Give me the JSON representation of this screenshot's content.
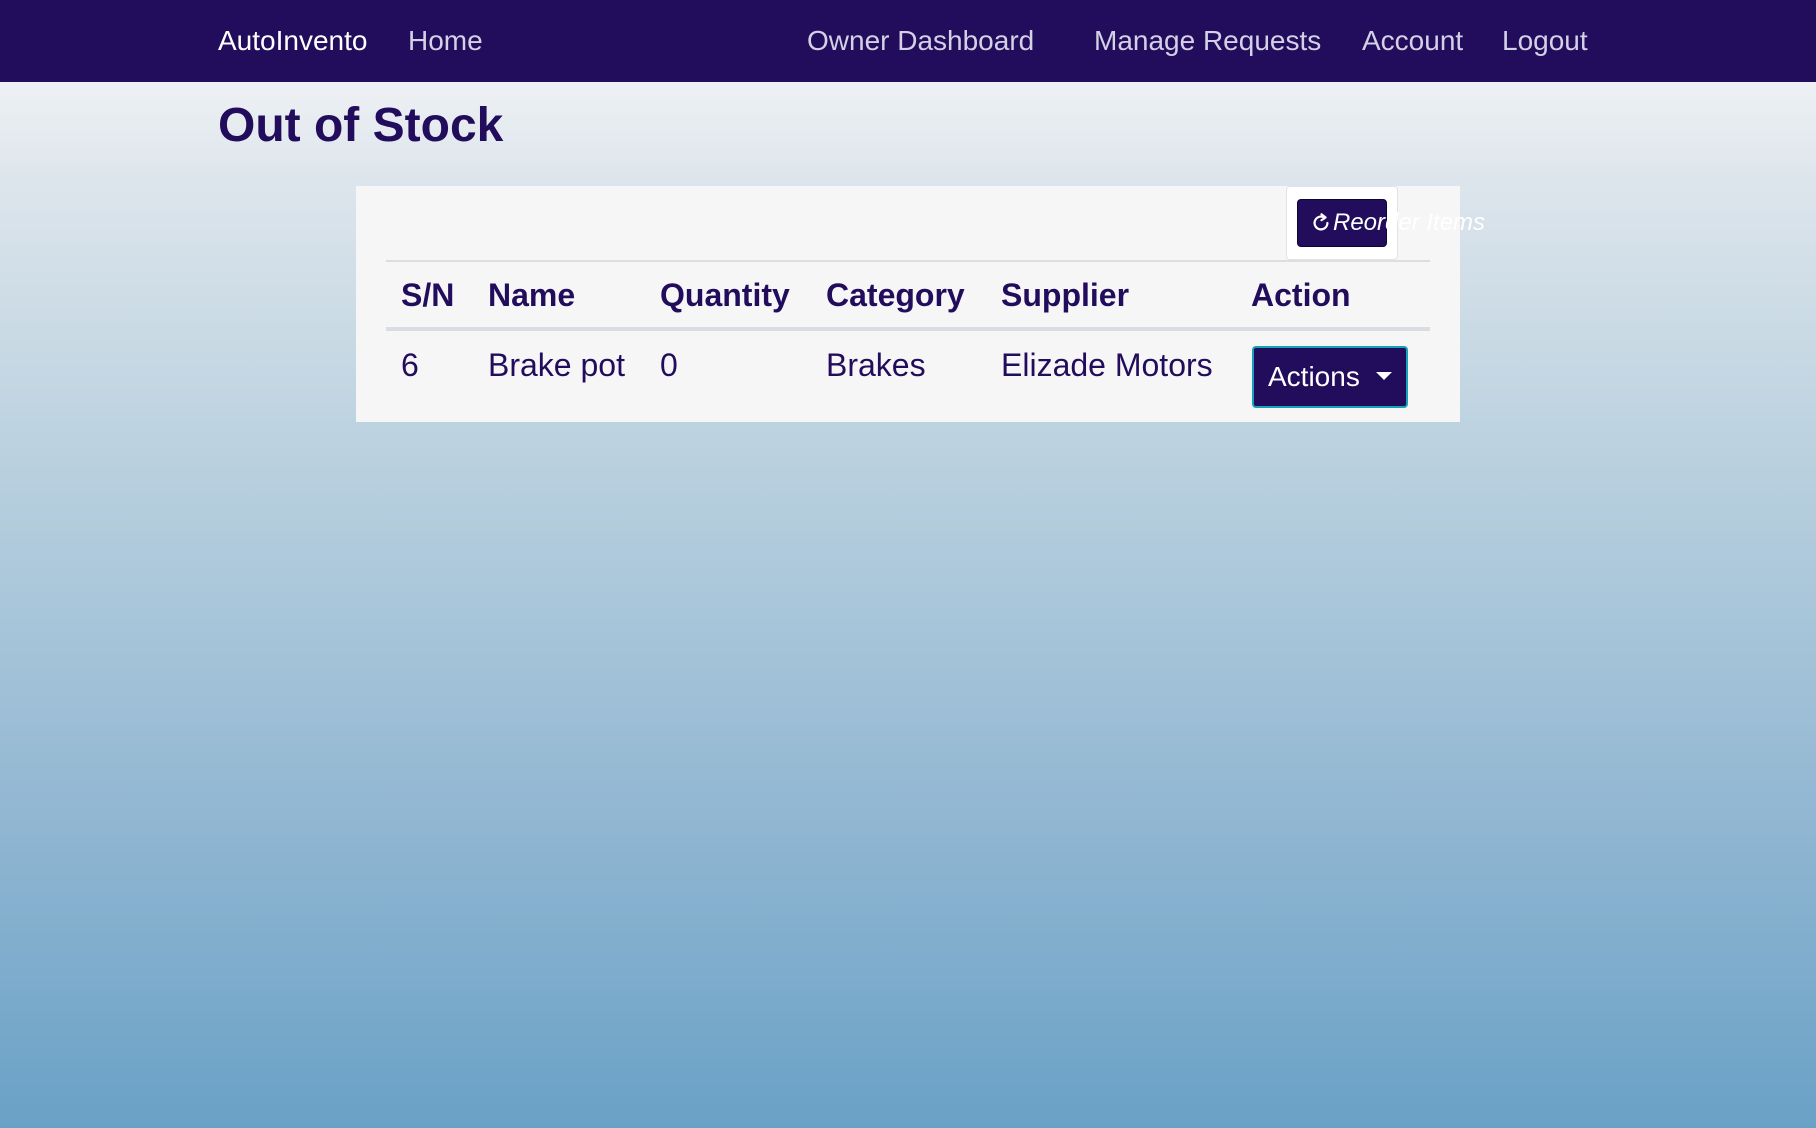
{
  "navbar": {
    "brand": "AutoInvento",
    "links": [
      "Home",
      "Owner Dashboard",
      "Manage Requests",
      "Account",
      "Logout"
    ],
    "background": "#220c5c"
  },
  "page": {
    "title": "Out of Stock"
  },
  "toolbar": {
    "reorder_label": "Reorder Items",
    "reorder_icon": "refresh-icon"
  },
  "table": {
    "headers": [
      "S/N",
      "Name",
      "Quantity",
      "Category",
      "Supplier",
      "Action"
    ],
    "rows": [
      {
        "sn": "6",
        "name": "Brake pot",
        "quantity": "0",
        "category": "Brakes",
        "supplier": "Elizade Motors",
        "action_label": "Actions",
        "action_icon": "caret-down-icon"
      }
    ]
  },
  "colors": {
    "primary": "#220c5c",
    "accent_border": "#17a2b8",
    "panel": "#f6f6f6"
  }
}
